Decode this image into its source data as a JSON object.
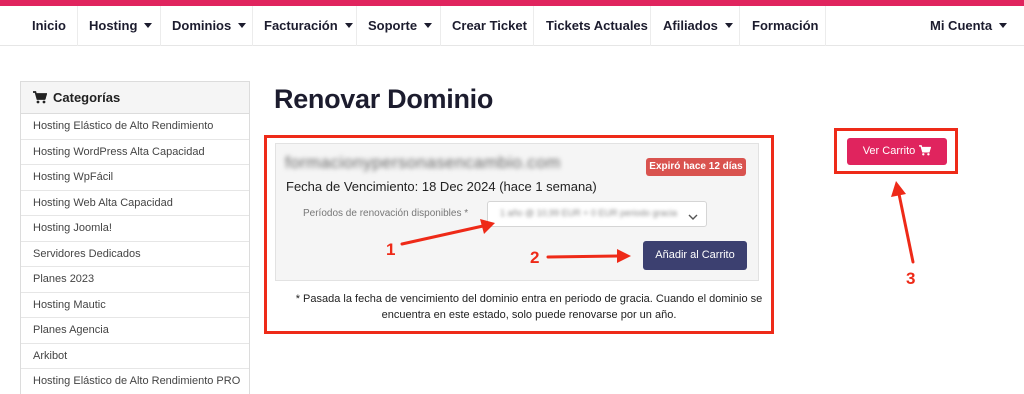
{
  "colors": {
    "accent": "#e0245e",
    "nav_text": "#1c1c2e",
    "annotation_red": "#ee2a18",
    "add_button": "#3c4070",
    "badge": "#d9534f"
  },
  "nav": {
    "items": [
      {
        "label": "Inicio",
        "dropdown": false
      },
      {
        "label": "Hosting",
        "dropdown": true
      },
      {
        "label": "Dominios",
        "dropdown": true
      },
      {
        "label": "Facturación",
        "dropdown": true
      },
      {
        "label": "Soporte",
        "dropdown": true
      },
      {
        "label": "Crear Ticket",
        "dropdown": false
      },
      {
        "label": "Tickets Actuales",
        "dropdown": false
      },
      {
        "label": "Afiliados",
        "dropdown": true
      },
      {
        "label": "Formación",
        "dropdown": false
      }
    ],
    "account": {
      "label": "Mi Cuenta",
      "dropdown": true
    }
  },
  "sidebar": {
    "title": "Categorías",
    "icon": "shopping-cart-icon",
    "items": [
      "Hosting Elástico de Alto Rendimiento",
      "Hosting WordPress Alta Capacidad",
      "Hosting WpFácil",
      "Hosting Web Alta Capacidad",
      "Hosting Joomla!",
      "Servidores Dedicados",
      "Planes 2023",
      "Hosting Mautic",
      "Planes Agencia",
      "Arkibot",
      "Hosting Elástico de Alto Rendimiento PRO"
    ]
  },
  "main": {
    "title": "Renovar Dominio",
    "domain": {
      "name": "formacionypersonasencambio.com",
      "badge": "Expiró hace 12 días",
      "expiry": "Fecha de Vencimiento: 18 Dec 2024 (hace 1 semana)",
      "period_label": "Períodos de renovación disponibles *",
      "period_value": "1 año @ 10,99 EUR + 0 EUR periodo gracia",
      "add_button": "Añadir al Carrito"
    },
    "note": "* Pasada la fecha de vencimiento del dominio entra en periodo de gracia. Cuando el dominio se encuentra en este estado, solo puede renovarse por un año."
  },
  "cart": {
    "label": "Ver Carrito",
    "icon": "shopping-cart-icon"
  },
  "annotations": [
    "1",
    "2",
    "3"
  ]
}
